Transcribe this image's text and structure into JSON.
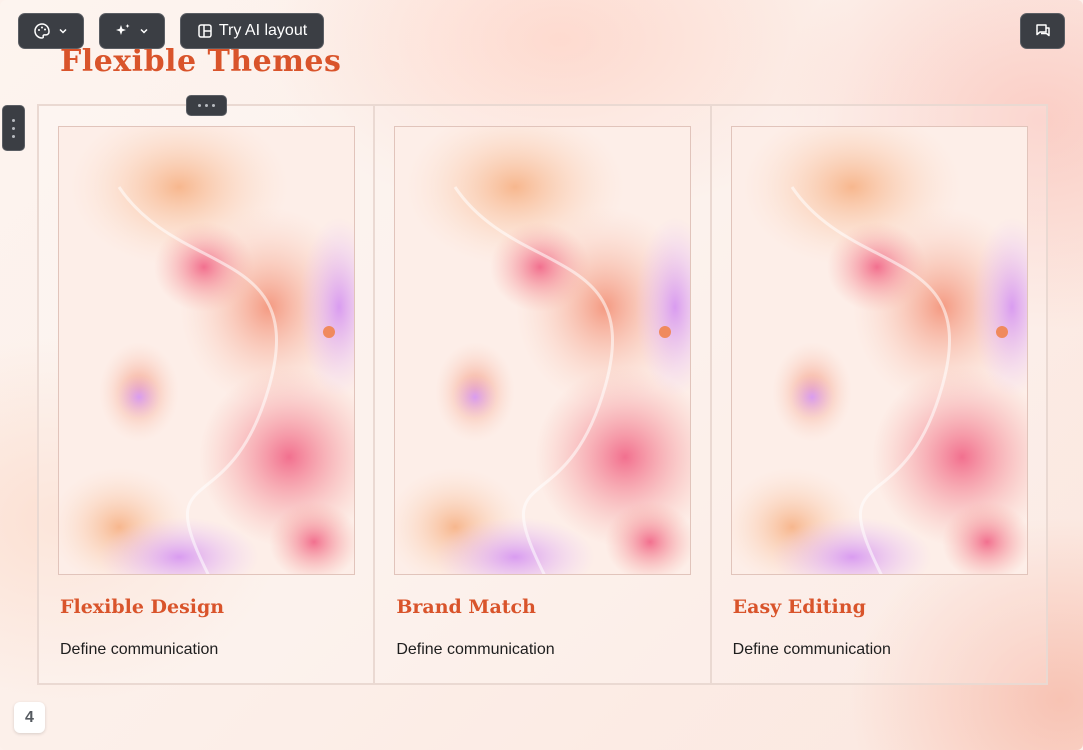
{
  "toolbar": {
    "theme_icon": "palette-icon",
    "ai_icon": "sparkle-icon",
    "layout_label": "Try AI layout",
    "layout_icon": "layout-icon",
    "comment_icon": "comment-icon"
  },
  "slide": {
    "title": "Flexible Themes",
    "cards": [
      {
        "title": "Flexible Design",
        "description": "Define communication"
      },
      {
        "title": "Brand Match",
        "description": "Define communication"
      },
      {
        "title": "Easy Editing",
        "description": "Define communication"
      }
    ],
    "page_number": "4"
  },
  "colors": {
    "accent": "#d9542b",
    "toolbar_bg": "#3b3e44",
    "border": "#ead9d2"
  }
}
